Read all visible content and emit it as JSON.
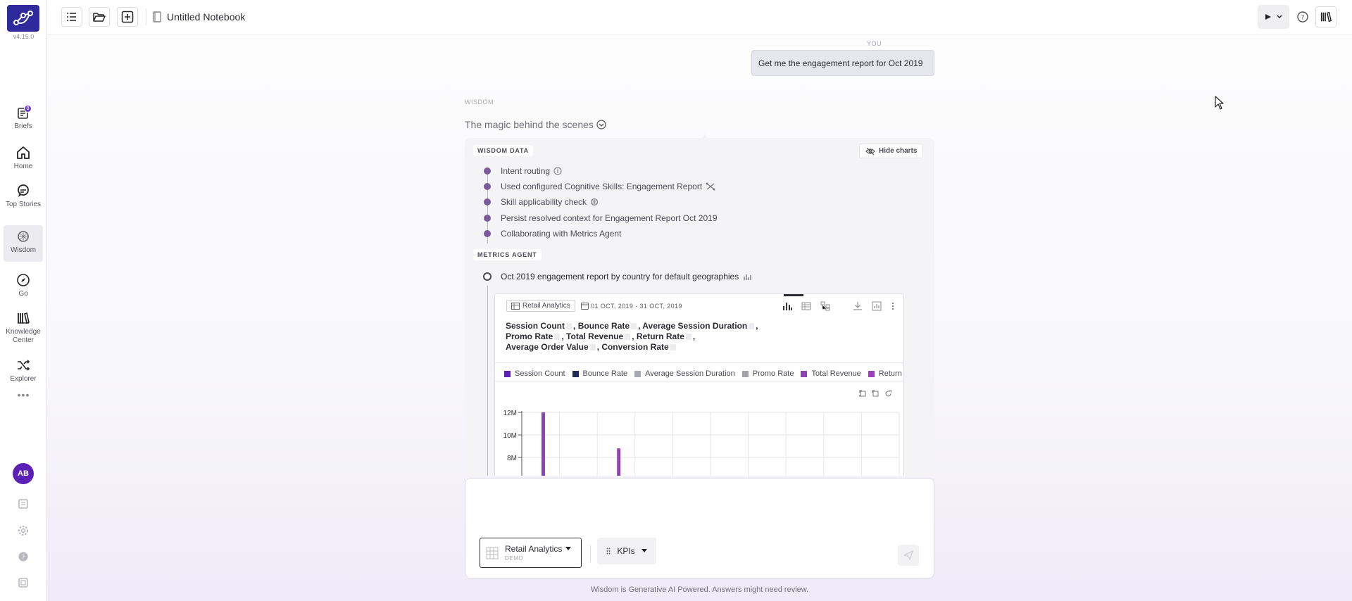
{
  "sidebar": {
    "version": "v4.15.0",
    "briefs_badge": "8",
    "items": [
      {
        "label": "Briefs"
      },
      {
        "label": "Home"
      },
      {
        "label": "Top Stories"
      },
      {
        "label": "Wisdom"
      },
      {
        "label": "Go"
      },
      {
        "label": "Knowledge Center"
      },
      {
        "label": "Explorer"
      }
    ],
    "more": "•••",
    "avatar_initials": "AB"
  },
  "topbar": {
    "notebook_title": "Untitled Notebook"
  },
  "conversation": {
    "you_label": "YOU",
    "user_message": "Get me the engagement report for Oct 2019",
    "wisdom_label": "WISDOM",
    "magic_title": "The magic behind the scenes"
  },
  "wisdom_data": {
    "tag": "WISDOM DATA",
    "hide_charts_label": "Hide charts",
    "steps": [
      {
        "label": "Intent routing"
      },
      {
        "label": "Used configured Cognitive Skills: Engagement Report"
      },
      {
        "label": "Skill applicability check"
      },
      {
        "label": "Persist resolved context for Engagement Report Oct 2019"
      },
      {
        "label": "Collaborating with Metrics Agent"
      }
    ]
  },
  "metrics_agent": {
    "tag": "METRICS AGENT",
    "step_label": "Oct 2019 engagement report by country for default geographies"
  },
  "report_card": {
    "dataset": "Retail Analytics",
    "date_range": "01 OCT, 2019 - 31 OCT, 2019",
    "measures_line1": [
      "Session Count",
      "Bounce Rate",
      "Average Session Duration"
    ],
    "measures_line2": [
      "Promo Rate",
      "Total Revenue",
      "Return Rate"
    ],
    "measures_line3": [
      "Average Order Value",
      "Conversion Rate"
    ],
    "comma": ","
  },
  "chart_data": {
    "type": "bar",
    "series": [
      {
        "name": "Session Count",
        "color": "#5b21b6"
      },
      {
        "name": "Bounce Rate",
        "color": "#1e2a5a"
      },
      {
        "name": "Average Session Duration",
        "color": "#a9a9b2"
      },
      {
        "name": "Promo Rate",
        "color": "#a3a3aa"
      },
      {
        "name": "Total Revenue",
        "color": "#8e44ad"
      },
      {
        "name": "Return",
        "color": "#9b3fc2"
      }
    ],
    "y_ticks": [
      "12M",
      "10M",
      "8M"
    ],
    "ylim": [
      8000000,
      12000000
    ],
    "visible_bars": [
      {
        "category_index": 0,
        "value": 12000000
      },
      {
        "category_index": 2,
        "value": 8800000
      }
    ],
    "category_count": 10,
    "grid": true
  },
  "composer": {
    "dataset_name": "Retail Analytics",
    "dataset_sub": "DEMO",
    "kpi_label": "KPIs"
  },
  "footer": {
    "disclaimer": "Wisdom is Generative AI Powered. Answers might need review."
  }
}
